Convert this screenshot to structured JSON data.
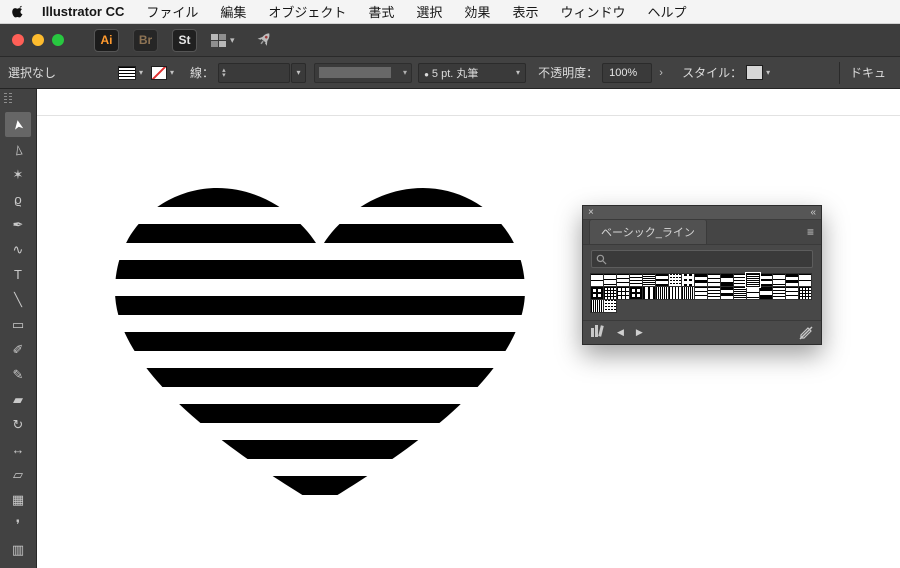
{
  "menu_bar": {
    "app_name": "Illustrator CC",
    "items": [
      "ファイル",
      "編集",
      "オブジェクト",
      "書式",
      "選択",
      "効果",
      "表示",
      "ウィンドウ",
      "ヘルプ"
    ]
  },
  "title_bar": {
    "ai_badge": "Ai",
    "br_badge": "Br",
    "st_badge": "St"
  },
  "control_bar": {
    "selection_status": "選択なし",
    "stroke_label": "線：",
    "stepper_up": "▴",
    "stepper_down": "▾",
    "dropdown_chevron": "▾",
    "brush_bullet": "●",
    "brush_value": "5 pt. 丸筆",
    "opacity_label": "不透明度：",
    "opacity_value": "100%",
    "opacity_more": "›",
    "style_label": "スタイル：",
    "document_button": "ドキュ"
  },
  "toolbar": {
    "tools": [
      {
        "name": "selection-tool",
        "glyph": "➤",
        "rotate": -100,
        "selected": true
      },
      {
        "name": "direct-selection-tool",
        "glyph": "▻",
        "rotate": -100
      },
      {
        "name": "magic-wand-tool",
        "glyph": "✶"
      },
      {
        "name": "lasso-tool",
        "glyph": "ϱ"
      },
      {
        "name": "pen-tool",
        "glyph": "✒"
      },
      {
        "name": "curvature-tool",
        "glyph": "∿"
      },
      {
        "name": "type-tool",
        "glyph": "T"
      },
      {
        "name": "line-segment-tool",
        "glyph": "╲"
      },
      {
        "name": "rectangle-tool",
        "glyph": "▭"
      },
      {
        "name": "paintbrush-tool",
        "glyph": "✐"
      },
      {
        "name": "pencil-tool",
        "glyph": "✎"
      },
      {
        "name": "eraser-tool",
        "glyph": "▰"
      },
      {
        "name": "rotate-tool",
        "glyph": "↻"
      },
      {
        "name": "width-tool",
        "glyph": "↔"
      },
      {
        "name": "free-transform-tool",
        "glyph": "▱"
      },
      {
        "name": "mesh-tool",
        "glyph": "▦"
      },
      {
        "name": "eyedropper-tool",
        "glyph": "❜"
      },
      {
        "name": "graph-tool",
        "glyph": "▥"
      }
    ]
  },
  "canvas": {
    "artwork_name": "striped-heart",
    "stripe_color": "#000000"
  },
  "panel": {
    "title": "ベーシック_ライン",
    "close_glyph": "×",
    "collapse_glyph": "«",
    "menu_glyph": "≡",
    "prev_glyph": "◀",
    "next_glyph": "▶",
    "search_placeholder": "",
    "selected_index": 12,
    "swatches": [
      "h5",
      "h4",
      "h3",
      "h2",
      "h1",
      "h6",
      "dash1",
      "dash2",
      "h7",
      "h3",
      "h8",
      "h2",
      "h1",
      "h6",
      "h4",
      "h7",
      "h5",
      "grid3",
      "grid1",
      "grid2",
      "grid3",
      "v3",
      "v1",
      "v2",
      "v1",
      "h3",
      "h2",
      "h7",
      "h1",
      "h4",
      "h8",
      "h2",
      "h3",
      "grid1",
      "v1",
      "dash1"
    ]
  }
}
